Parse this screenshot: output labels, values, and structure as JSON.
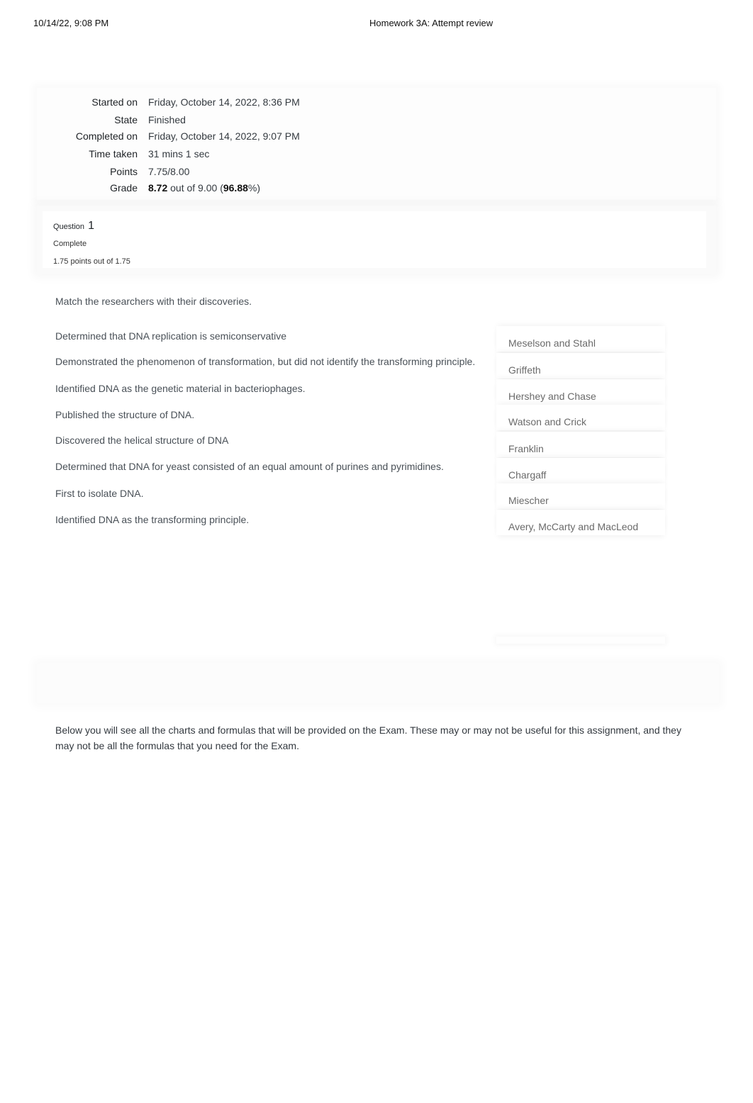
{
  "print_header": {
    "datetime": "10/14/22, 9:08 PM",
    "title": "Homework 3A: Attempt review"
  },
  "summary": {
    "rows": [
      {
        "label": "Started on",
        "value": "Friday, October 14, 2022, 8:36 PM"
      },
      {
        "label": "State",
        "value": "Finished"
      },
      {
        "label": "Completed on",
        "value": "Friday, October 14, 2022, 9:07 PM"
      },
      {
        "label": "Time taken",
        "value": "31 mins 1 sec"
      },
      {
        "label": "Points",
        "value": "7.75/8.00"
      }
    ],
    "grade": {
      "label": "Grade",
      "score": "8.72",
      "out_of_text": " out of 9.00 (",
      "percent": "96.88",
      "suffix": "%)"
    }
  },
  "question": {
    "label": "Question",
    "number": "1",
    "state": "Complete",
    "grade": "1.75 points out of 1.75",
    "prompt": "Match the researchers with their discoveries.",
    "stems": [
      "Determined that DNA replication is semiconservative",
      "Demonstrated the phenomenon of transformation, but did not identify the transforming principle.",
      "Identified DNA as the genetic material in bacteriophages.",
      "Published the structure of DNA.",
      "Discovered the helical structure of DNA",
      "Determined that DNA for yeast consisted of an equal amount of purines and pyrimidines.",
      "First to isolate DNA.",
      "Identified DNA as the transforming principle."
    ],
    "answers": [
      "Meselson and Stahl",
      "Griffeth",
      "Hershey and Chase",
      "Watson and Crick",
      "Franklin",
      "Chargaff",
      "Miescher",
      "Avery, McCarty and MacLeod"
    ]
  },
  "exam_note": "Below you will see all the charts and formulas that will be provided on the Exam. These may or may not be useful for this assignment, and they may not be all the formulas that you need for the Exam."
}
